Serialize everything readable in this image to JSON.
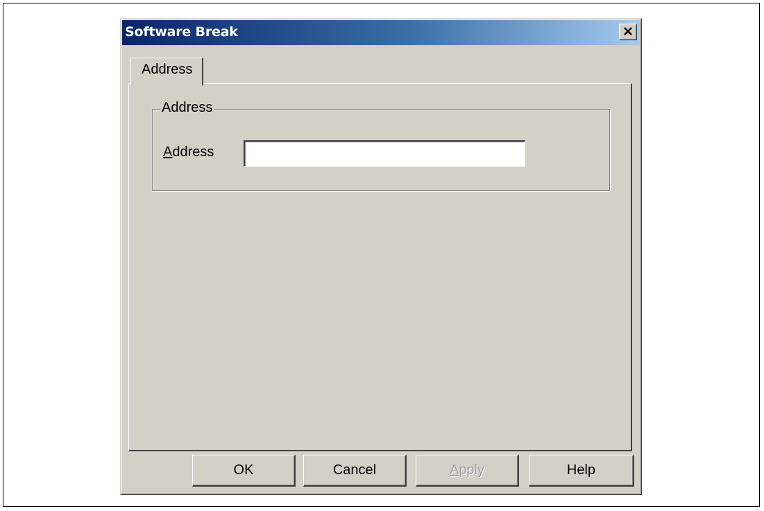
{
  "window": {
    "title": "Software Break",
    "close_icon": "close-icon"
  },
  "tabs": [
    {
      "label": "Address",
      "selected": true
    }
  ],
  "address_group": {
    "label": "Address",
    "field_label_accesskey": "A",
    "field_label_rest": "ddress",
    "input_value": ""
  },
  "buttons": {
    "ok": "OK",
    "cancel": "Cancel",
    "apply_accesskey": "A",
    "apply_rest": "pply",
    "apply_enabled": false,
    "help": "Help"
  },
  "colors": {
    "dialog_face": "#d4d0c8",
    "title_start": "#0a246a",
    "title_end": "#a6caf0"
  }
}
